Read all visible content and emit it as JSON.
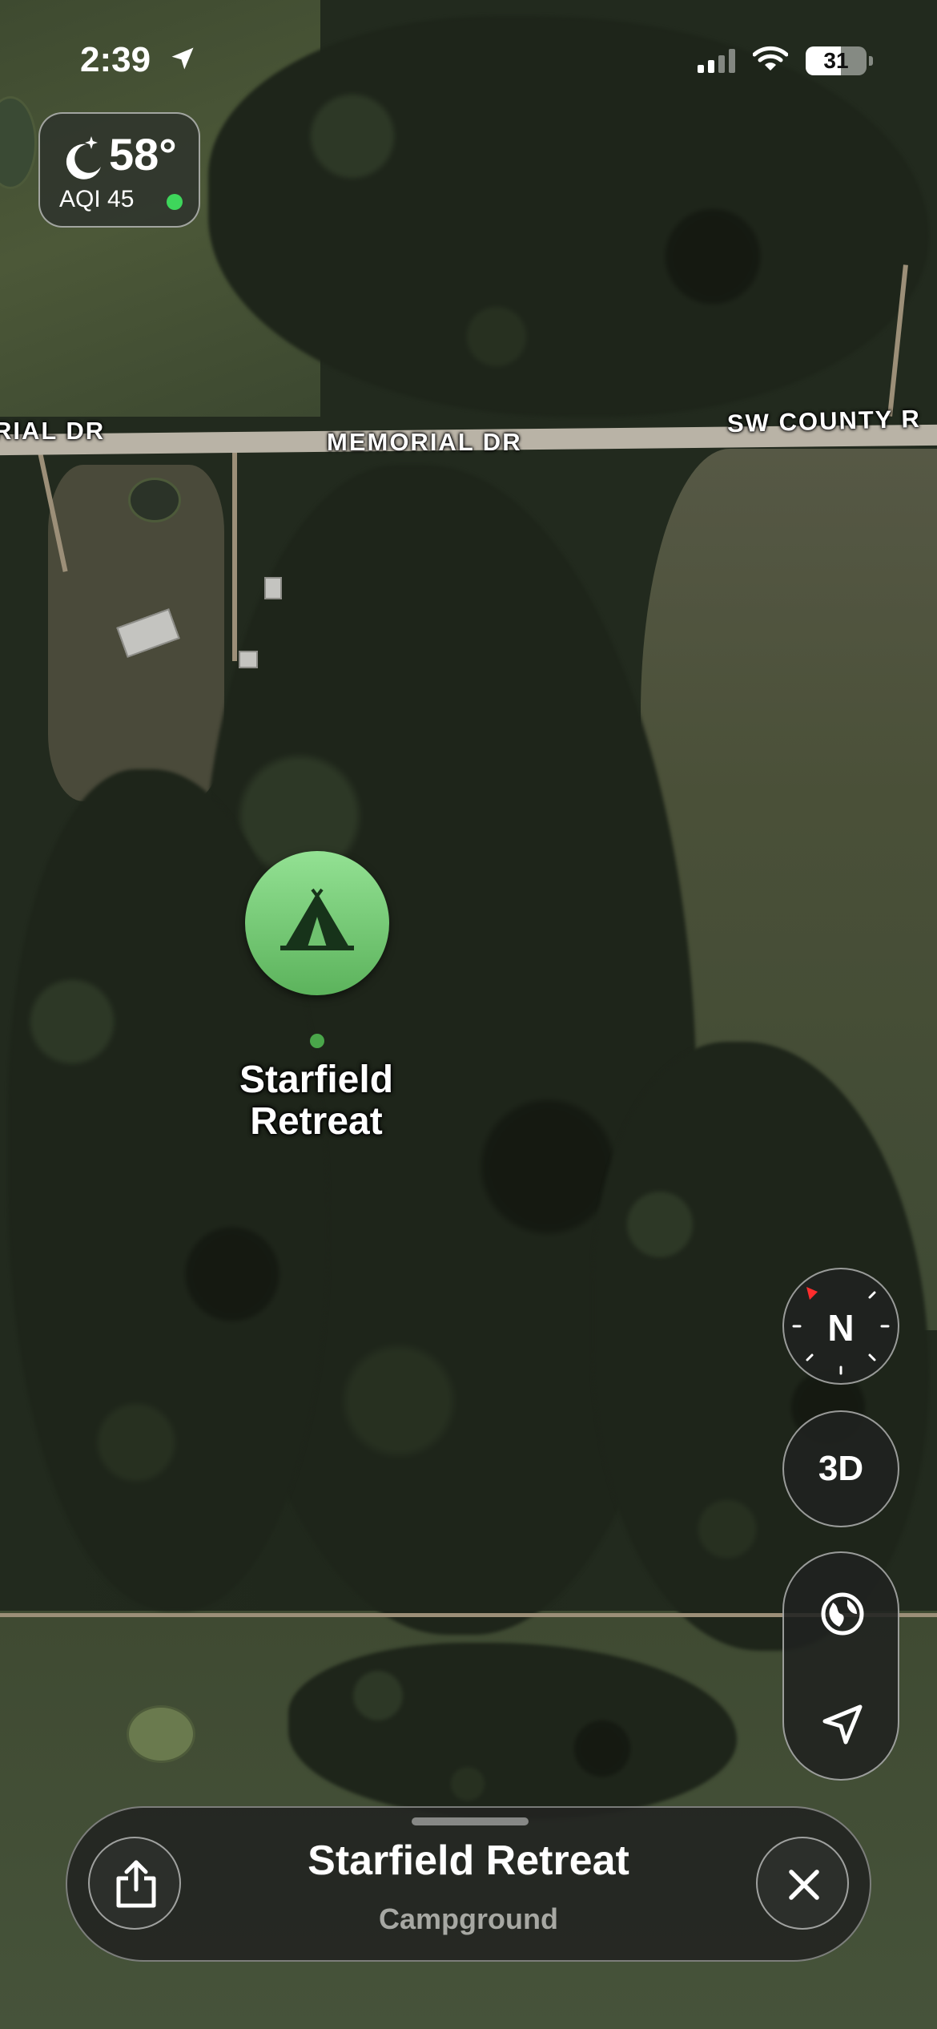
{
  "status_bar": {
    "time": "2:39",
    "battery": "31"
  },
  "weather": {
    "temperature": "58°",
    "aqi": "AQI 45",
    "aqi_color": "#3ed65b"
  },
  "map": {
    "roads": [
      "RIAL DR",
      "MEMORIAL DR",
      "SW COUNTY R"
    ],
    "place": {
      "name": "Starfield Retreat",
      "category_icon": "tent-icon",
      "pin_color": "#6cc46c"
    }
  },
  "controls": {
    "compass": "N",
    "view_3d": "3D",
    "globe_icon": "globe-icon",
    "location_icon": "location-arrow-icon"
  },
  "card": {
    "title": "Starfield Retreat",
    "subtitle": "Campground"
  }
}
